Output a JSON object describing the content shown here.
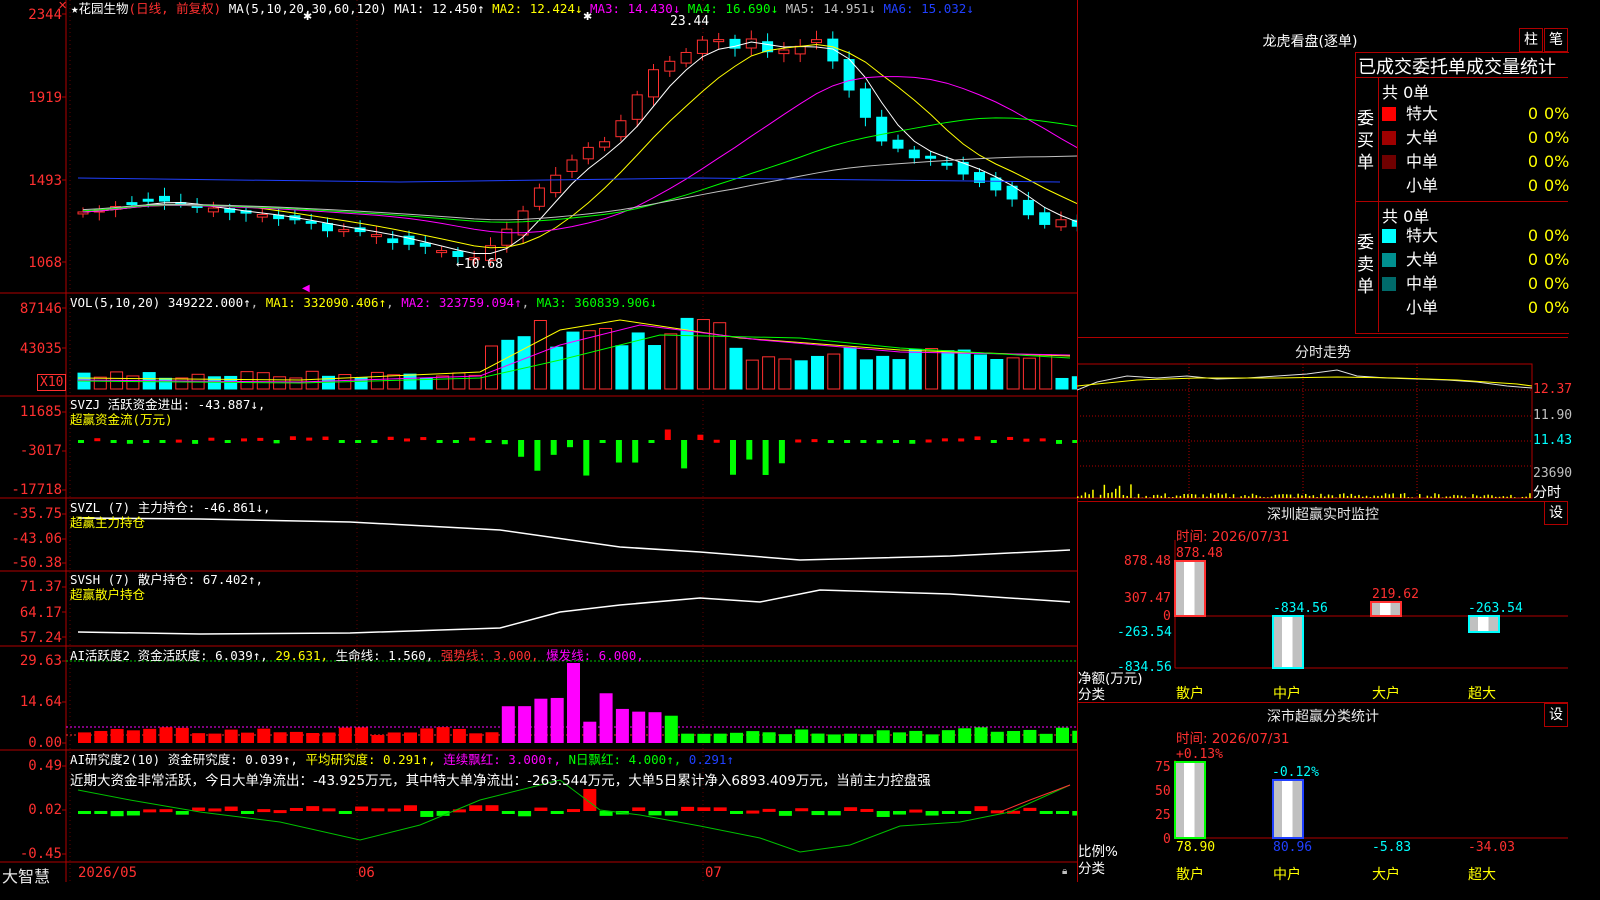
{
  "kline": {
    "star": "★",
    "stock_name": "花园生物",
    "period": "(日线, 前复权)",
    "ma_label": "MA(5,10,20,30,60,120)",
    "ma": [
      {
        "text": "MA1: 12.450↑",
        "color": "#ffffff"
      },
      {
        "text": "MA2: 12.424↓",
        "color": "#ffff00"
      },
      {
        "text": "MA3: 14.430↓",
        "color": "#ff00ff"
      },
      {
        "text": "MA4: 16.690↓",
        "color": "#00ff00"
      },
      {
        "text": "MA5: 14.951↓",
        "color": "#c0c0c0"
      },
      {
        "text": "MA6: 15.032↓",
        "color": "#2040ff"
      }
    ],
    "y_ticks": [
      "2344",
      "1919",
      "1493",
      "1068"
    ],
    "high_mark": "23.44",
    "low_mark": "←10.68",
    "x_ticks": [
      "2026/05",
      "06",
      "07"
    ]
  },
  "vol": {
    "label": "VOL(5,10,20)",
    "value": "349222.000↑",
    "ma": [
      {
        "text": "MA1: 332090.406↑",
        "color": "#ffff00"
      },
      {
        "text": "MA2: 323759.094↑",
        "color": "#ff00ff"
      },
      {
        "text": "MA3: 360839.906↓",
        "color": "#00ff00"
      }
    ],
    "y_ticks": [
      "87146",
      "43035"
    ],
    "unit": "X10"
  },
  "svzj": {
    "label": "SVZJ  活跃资金进出: -43.887↓,",
    "sub": "超赢资金流(万元)",
    "y_ticks": [
      "11685",
      "-3017",
      "-17718"
    ]
  },
  "svzl": {
    "label": "SVZL (7) 主力持仓: -46.861↓,",
    "sub": "超赢主力持仓",
    "y_ticks": [
      "-35.75",
      "-43.06",
      "-50.38"
    ]
  },
  "svsh": {
    "label": "SVSH (7) 散户持仓: 67.402↑,",
    "sub": "超赢散户持仓",
    "y_ticks": [
      "71.37",
      "64.17",
      "57.24"
    ]
  },
  "ai2": {
    "label": "AI活跃度2 资金活跃度: 6.039↑,",
    "v2": "29.631,",
    "v3": "生命线: 1.560,",
    "v4": "强势线: 3.000,",
    "v5": "爆发线: 6.000,",
    "y_ticks": [
      "29.63",
      "14.64",
      "0.00"
    ]
  },
  "ai_research": {
    "label": "AI研究度2(10) 资金研究度: 0.039↑,",
    "v2": "平均研究度: 0.291↑,",
    "v3": "连续飘红: 3.000↑,",
    "v4": "N日飘红: 4.000↑,",
    "v5": "0.291↑",
    "summary": "近期大资金非常活跃，今日大单净流出：-43.925万元，其中特大单净流出：-263.544万元，大单5日累计净入6893.409万元，当前主力控盘强",
    "y_ticks": [
      "0.49",
      "0.02",
      "-0.45"
    ]
  },
  "brand": "大智慧",
  "dragon": {
    "title": "龙虎看盘(逐单)",
    "btn1": "柱",
    "btn2": "笔",
    "header": "已成交委托单成交量统计",
    "buy_label": "委买单",
    "sell_label": "委卖单",
    "buy_total": "共 0单",
    "sell_total": "共 0单",
    "buy_rows": [
      {
        "name": "特大",
        "v1": "0",
        "v2": "0%",
        "color": "#ff0000"
      },
      {
        "name": "大单",
        "v1": "0",
        "v2": "0%",
        "color": "#a00000"
      },
      {
        "name": "中单",
        "v1": "0",
        "v2": "0%",
        "color": "#700000"
      },
      {
        "name": "小单",
        "v1": "0",
        "v2": "0%",
        "color": ""
      }
    ],
    "sell_rows": [
      {
        "name": "特大",
        "v1": "0",
        "v2": "0%",
        "color": "#00ffff"
      },
      {
        "name": "大单",
        "v1": "0",
        "v2": "0%",
        "color": "#009090"
      },
      {
        "name": "中单",
        "v1": "0",
        "v2": "0%",
        "color": "#006a6a"
      },
      {
        "name": "小单",
        "v1": "0",
        "v2": "0%",
        "color": ""
      }
    ]
  },
  "intraday": {
    "title": "分时走势",
    "y_ticks": [
      "12.37",
      "11.90",
      "11.43"
    ],
    "vol_tick": "23690",
    "footer": "分时"
  },
  "sz_monitor": {
    "title": "深圳超赢实时监控",
    "set": "设",
    "time": "时间: 2026/07/31",
    "y_ticks": [
      "878.48",
      "307.47",
      "0",
      "-263.54",
      "-834.56"
    ],
    "cats": [
      "散户",
      "中户",
      "大户",
      "超大"
    ],
    "values": [
      878.48,
      -834.56,
      219.62,
      -263.54
    ],
    "value_labels": [
      "878.48",
      "-834.56",
      "219.62",
      "-263.54"
    ],
    "axis_label1": "净额(万元)",
    "axis_label2": "分类"
  },
  "sz_class": {
    "title": "深市超赢分类统计",
    "set": "设",
    "time": "时间: 2026/07/31",
    "y_ticks": [
      "75",
      "50",
      "25",
      "0"
    ],
    "top_labels": [
      "+0.13%",
      "-0.12%"
    ],
    "bottom_values": [
      "78.90",
      "80.96",
      "-5.83",
      "-34.03"
    ],
    "cats": [
      "散户",
      "中户",
      "大户",
      "超大"
    ],
    "axis_label1": "比例%",
    "axis_label2": "分类"
  }
}
